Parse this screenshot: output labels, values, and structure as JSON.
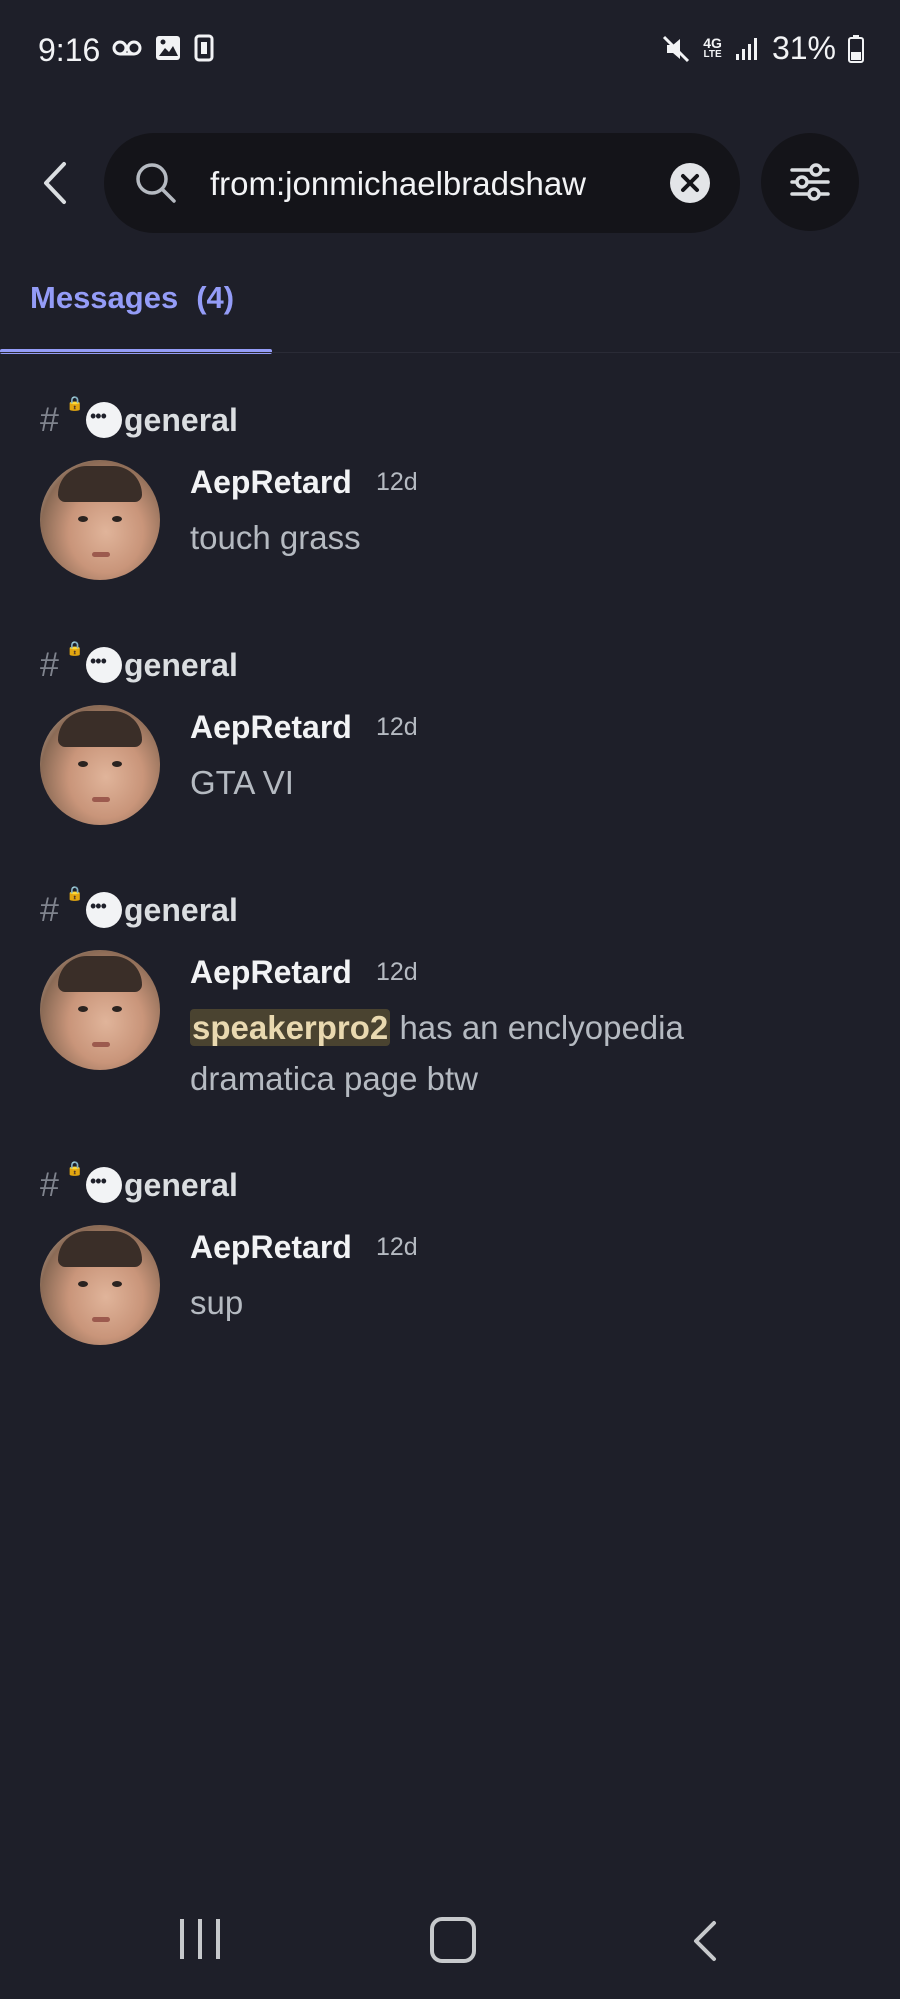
{
  "status_bar": {
    "time": "9:16",
    "network": "4G",
    "network_sub": "LTE",
    "battery": "31%"
  },
  "search": {
    "query": "from:jonmichaelbradshaw"
  },
  "tabs": [
    {
      "label": "Messages",
      "count": "(4)"
    }
  ],
  "results": [
    {
      "channel": "general",
      "author": "AepRetard",
      "time": "12d",
      "content": "touch grass"
    },
    {
      "channel": "general",
      "author": "AepRetard",
      "time": "12d",
      "content": "GTA VI"
    },
    {
      "channel": "general",
      "author": "AepRetard",
      "time": "12d",
      "mention": "speakerpro2",
      "content": " has an enclyopedia dramatica page btw"
    },
    {
      "channel": "general",
      "author": "AepRetard",
      "time": "12d",
      "content": "sup"
    }
  ]
}
